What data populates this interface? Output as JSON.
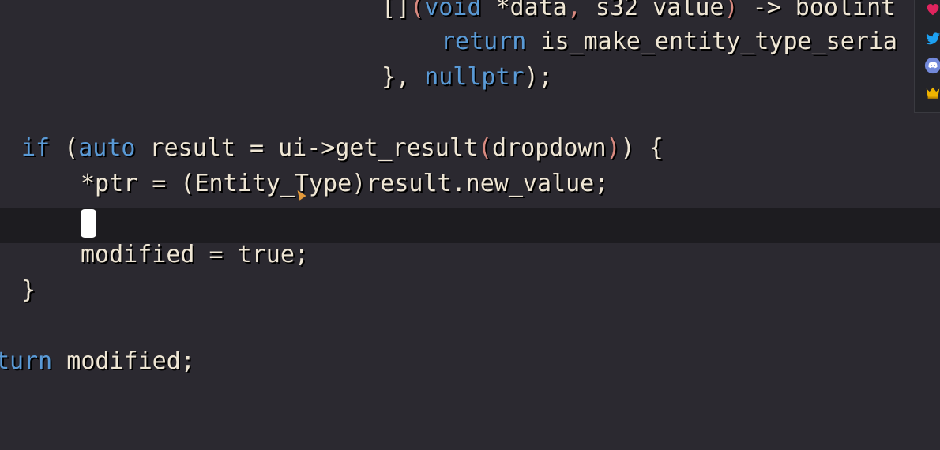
{
  "editor": {
    "lines": {
      "l1": {
        "punct_open": "[]",
        "paren_open": "(",
        "kw_void": "void",
        "t1": " *data",
        "comma": ",",
        "t2": " s32 value",
        "paren_close": ")",
        "t3": " -> boolint"
      },
      "l2": {
        "kw_return": "return",
        "text": " is_make_entity_type_seria"
      },
      "l3": {
        "text": "}, ",
        "kw_nullptr": "nullptr",
        "end": ");"
      },
      "l4": {
        "kw_if": "if",
        "t1": " (",
        "kw_auto": "auto",
        "t2": " result = ui->get_result",
        "paren_open": "(",
        "t3": "dropdown",
        "paren_close": ")",
        "t4": ") {"
      },
      "l5": {
        "text": "*ptr = (Entity_Type)result.new_value;"
      },
      "l7": {
        "text": "modified = true;"
      },
      "l8": {
        "text": "}"
      },
      "l10": {
        "kw": "turn",
        "text": " modified;"
      }
    }
  },
  "social_bar": {
    "icons": [
      "heart-icon",
      "twitter-icon",
      "discord-icon",
      "crown-icon"
    ],
    "colors": {
      "heart": "#e0245e",
      "twitter": "#1da1f2",
      "discord": "#7289da",
      "crown": "#f0b400"
    }
  },
  "colors": {
    "background": "#2b2930",
    "current_line": "#1d1c20",
    "text": "#efe6d4",
    "keyword": "#5a9ad6",
    "paren": "#d98a80"
  }
}
